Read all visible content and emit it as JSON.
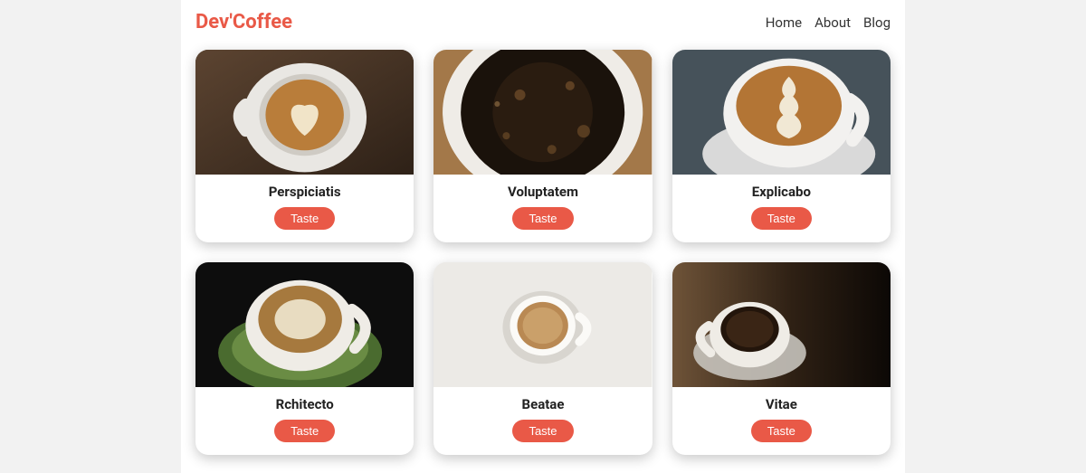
{
  "header": {
    "logo": "Dev'Coffee",
    "nav": [
      "Home",
      "About",
      "Blog"
    ]
  },
  "cards": [
    {
      "title": "Perspiciatis",
      "button": "Taste"
    },
    {
      "title": "Voluptatem",
      "button": "Taste"
    },
    {
      "title": "Explicabo",
      "button": "Taste"
    },
    {
      "title": "Rchitecto",
      "button": "Taste"
    },
    {
      "title": "Beatae",
      "button": "Taste"
    },
    {
      "title": "Vitae",
      "button": "Taste"
    }
  ],
  "colors": {
    "accent": "#e95947"
  }
}
